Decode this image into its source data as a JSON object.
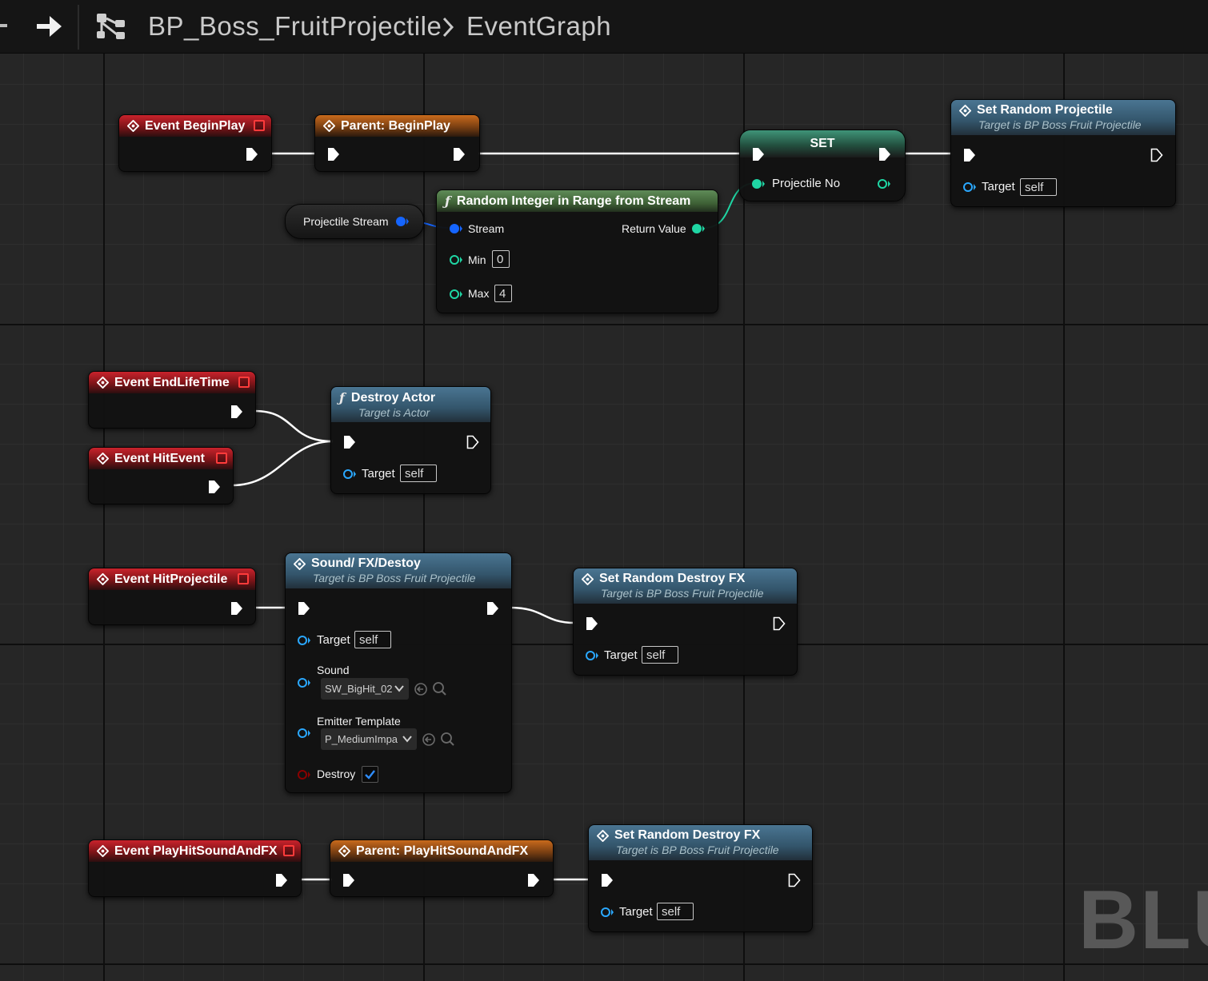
{
  "breadcrumb": {
    "blueprint": "BP_Boss_FruitProjectile",
    "separator": "›",
    "graph": "EventGraph"
  },
  "icons": {
    "back": "arrow-right-icon",
    "graph": "graph-tree-icon",
    "event": "event-diamond-icon",
    "function": "function-f-icon"
  },
  "colors": {
    "exec": "#ffffff",
    "stream_pin": "#1565ff",
    "int_pin": "#1fd6a4",
    "object_pin": "#2aa8ff",
    "bool_pin": "#8a0000",
    "event_header": "#c9232c",
    "parent_header": "#c96a1c",
    "call_header": "#4a7592",
    "pure_header": "#5f8b58",
    "set_header": "#3f9478"
  },
  "nodes": {
    "begin_play": {
      "title": "Event BeginPlay"
    },
    "parent_begin_play": {
      "title": "Parent: BeginPlay"
    },
    "set_node": {
      "title": "SET",
      "var": "Projectile No"
    },
    "set_random_projectile": {
      "title": "Set Random Projectile",
      "subtitle": "Target is BP Boss Fruit Projectile",
      "target_label": "Target",
      "target_value": "self"
    },
    "projectile_stream": {
      "label": "Projectile Stream"
    },
    "random_int": {
      "title": "Random Integer in Range from Stream",
      "stream_label": "Stream",
      "return_label": "Return Value",
      "min_label": "Min",
      "min_value": "0",
      "max_label": "Max",
      "max_value": "4"
    },
    "end_life_time": {
      "title": "Event EndLifeTime"
    },
    "hit_event": {
      "title": "Event HitEvent"
    },
    "destroy_actor": {
      "title": "Destroy Actor",
      "subtitle": "Target is Actor",
      "target_label": "Target",
      "target_value": "self"
    },
    "hit_projectile": {
      "title": "Event HitProjectile"
    },
    "sound_fx_destroy": {
      "title": "Sound/ FX/Destoy",
      "subtitle": "Target is BP Boss Fruit Projectile",
      "target_label": "Target",
      "target_value": "self",
      "sound_label": "Sound",
      "sound_value": "SW_BigHit_02",
      "emitter_label": "Emitter Template",
      "emitter_value": "P_MediumImpa",
      "destroy_label": "Destroy",
      "destroy_checked": true
    },
    "set_random_destroy_fx_1": {
      "title": "Set Random Destroy FX",
      "subtitle": "Target is BP Boss Fruit Projectile",
      "target_label": "Target",
      "target_value": "self"
    },
    "play_hit_sound": {
      "title": "Event PlayHitSoundAndFX"
    },
    "parent_play_hit_sound": {
      "title": "Parent: PlayHitSoundAndFX"
    },
    "set_random_destroy_fx_2": {
      "title": "Set Random Destroy FX",
      "subtitle": "Target is BP Boss Fruit Projectile",
      "target_label": "Target",
      "target_value": "self"
    }
  },
  "watermark": "BLU"
}
